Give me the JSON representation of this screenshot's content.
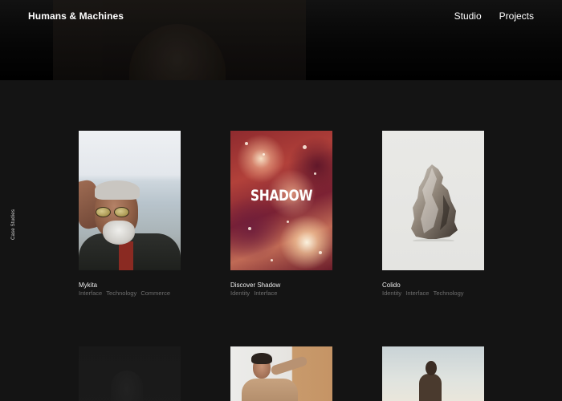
{
  "header": {
    "logo": "Humans & Machines",
    "nav": [
      {
        "label": "Studio"
      },
      {
        "label": "Projects"
      }
    ]
  },
  "side_label": "Case Studies",
  "projects": [
    {
      "title": "Mykita",
      "tags": [
        "Interface",
        "Technology",
        "Commerce"
      ]
    },
    {
      "title": "Discover Shadow",
      "tags": [
        "Identity",
        "Interface"
      ],
      "image_text": "SHADOW"
    },
    {
      "title": "Colido",
      "tags": [
        "Identity",
        "Interface",
        "Technology"
      ]
    }
  ],
  "colors": {
    "background": "#141414",
    "header": "#000000",
    "text": "#ffffff",
    "tag_text": "#6e6e6e"
  }
}
